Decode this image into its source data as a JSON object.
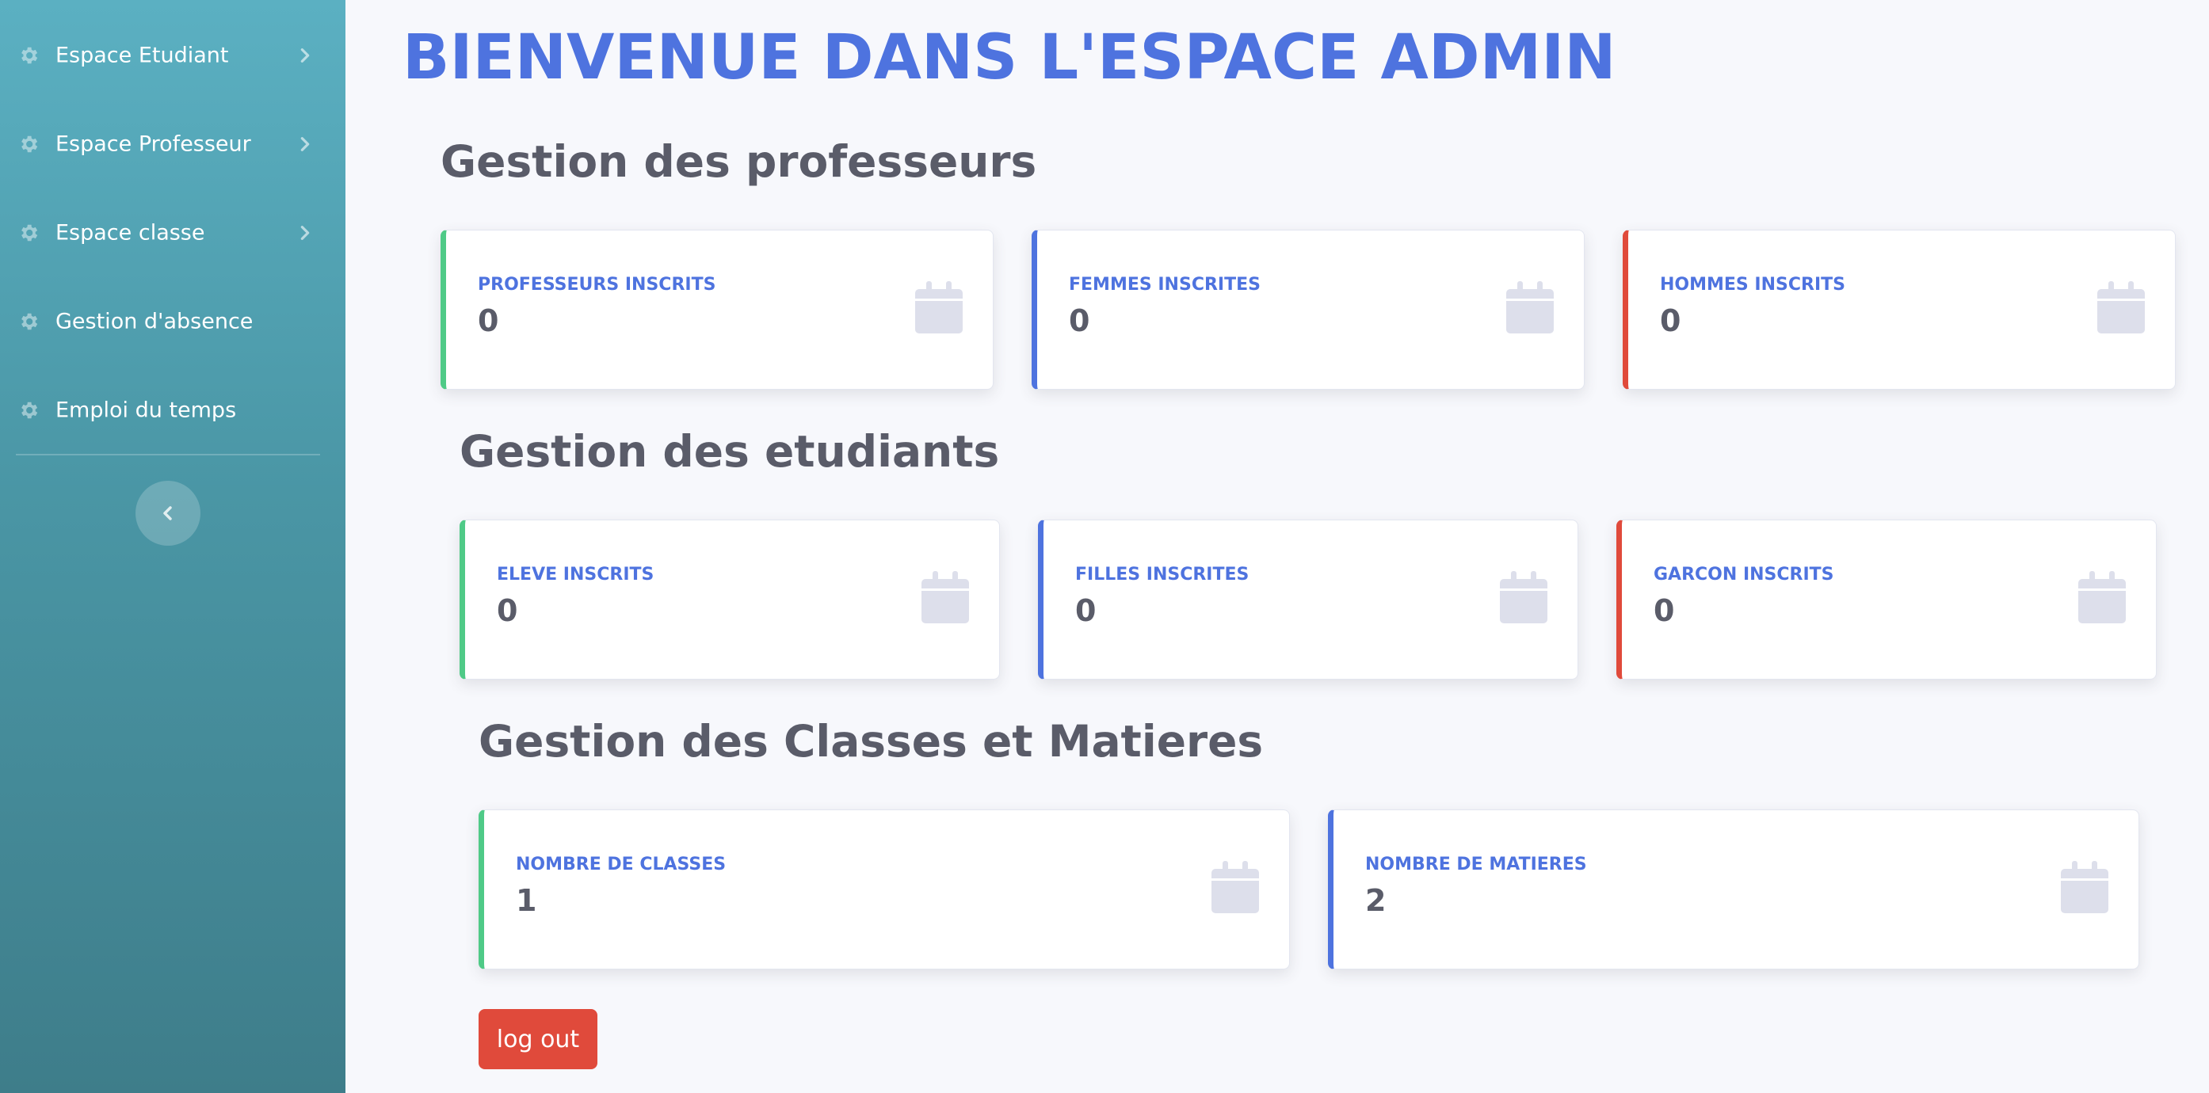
{
  "sidebar": {
    "items": [
      {
        "label": "Espace Etudiant",
        "icon": "gear-icon",
        "has_chevron": true
      },
      {
        "label": "Espace Professeur",
        "icon": "gear-icon",
        "has_chevron": true
      },
      {
        "label": "Espace classe",
        "icon": "gear-icon",
        "has_chevron": true
      },
      {
        "label": "Gestion d'absence",
        "icon": "gear-icon",
        "has_chevron": false
      },
      {
        "label": "Emploi du temps",
        "icon": "gear-icon",
        "has_chevron": false
      }
    ],
    "toggle_icon": "chevron-left-icon"
  },
  "main": {
    "title": "BIENVENUE DANS L'ESPACE ADMIN",
    "sections": [
      {
        "title": "Gestion des professeurs",
        "cards": [
          {
            "label": "PROFESSEURS INSCRITS",
            "value": "0",
            "accent": "green",
            "icon": "calendar-icon"
          },
          {
            "label": "FEMMES INSCRITES",
            "value": "0",
            "accent": "blue",
            "icon": "calendar-icon"
          },
          {
            "label": "HOMMES INSCRITS",
            "value": "0",
            "accent": "red",
            "icon": "calendar-icon"
          }
        ]
      },
      {
        "title": "Gestion des etudiants",
        "cards": [
          {
            "label": "ELEVE INSCRITS",
            "value": "0",
            "accent": "green",
            "icon": "calendar-icon"
          },
          {
            "label": "FILLES INSCRITES",
            "value": "0",
            "accent": "blue",
            "icon": "calendar-icon"
          },
          {
            "label": "GARCON INSCRITS",
            "value": "0",
            "accent": "red",
            "icon": "calendar-icon"
          }
        ]
      },
      {
        "title": "Gestion des Classes et Matieres",
        "cards": [
          {
            "label": "NOMBRE DE CLASSES",
            "value": "1",
            "accent": "green",
            "icon": "calendar-icon"
          },
          {
            "label": "NOMBRE DE MATIERES",
            "value": "2",
            "accent": "blue",
            "icon": "calendar-icon"
          }
        ]
      }
    ],
    "logout_label": "log out"
  },
  "colors": {
    "primary": "#4e73df",
    "success": "#4fca87",
    "danger": "#e04a3b",
    "text": "#5a5c69",
    "sidebar_top": "#5bb0c2",
    "sidebar_bottom": "#3e7d8a"
  }
}
